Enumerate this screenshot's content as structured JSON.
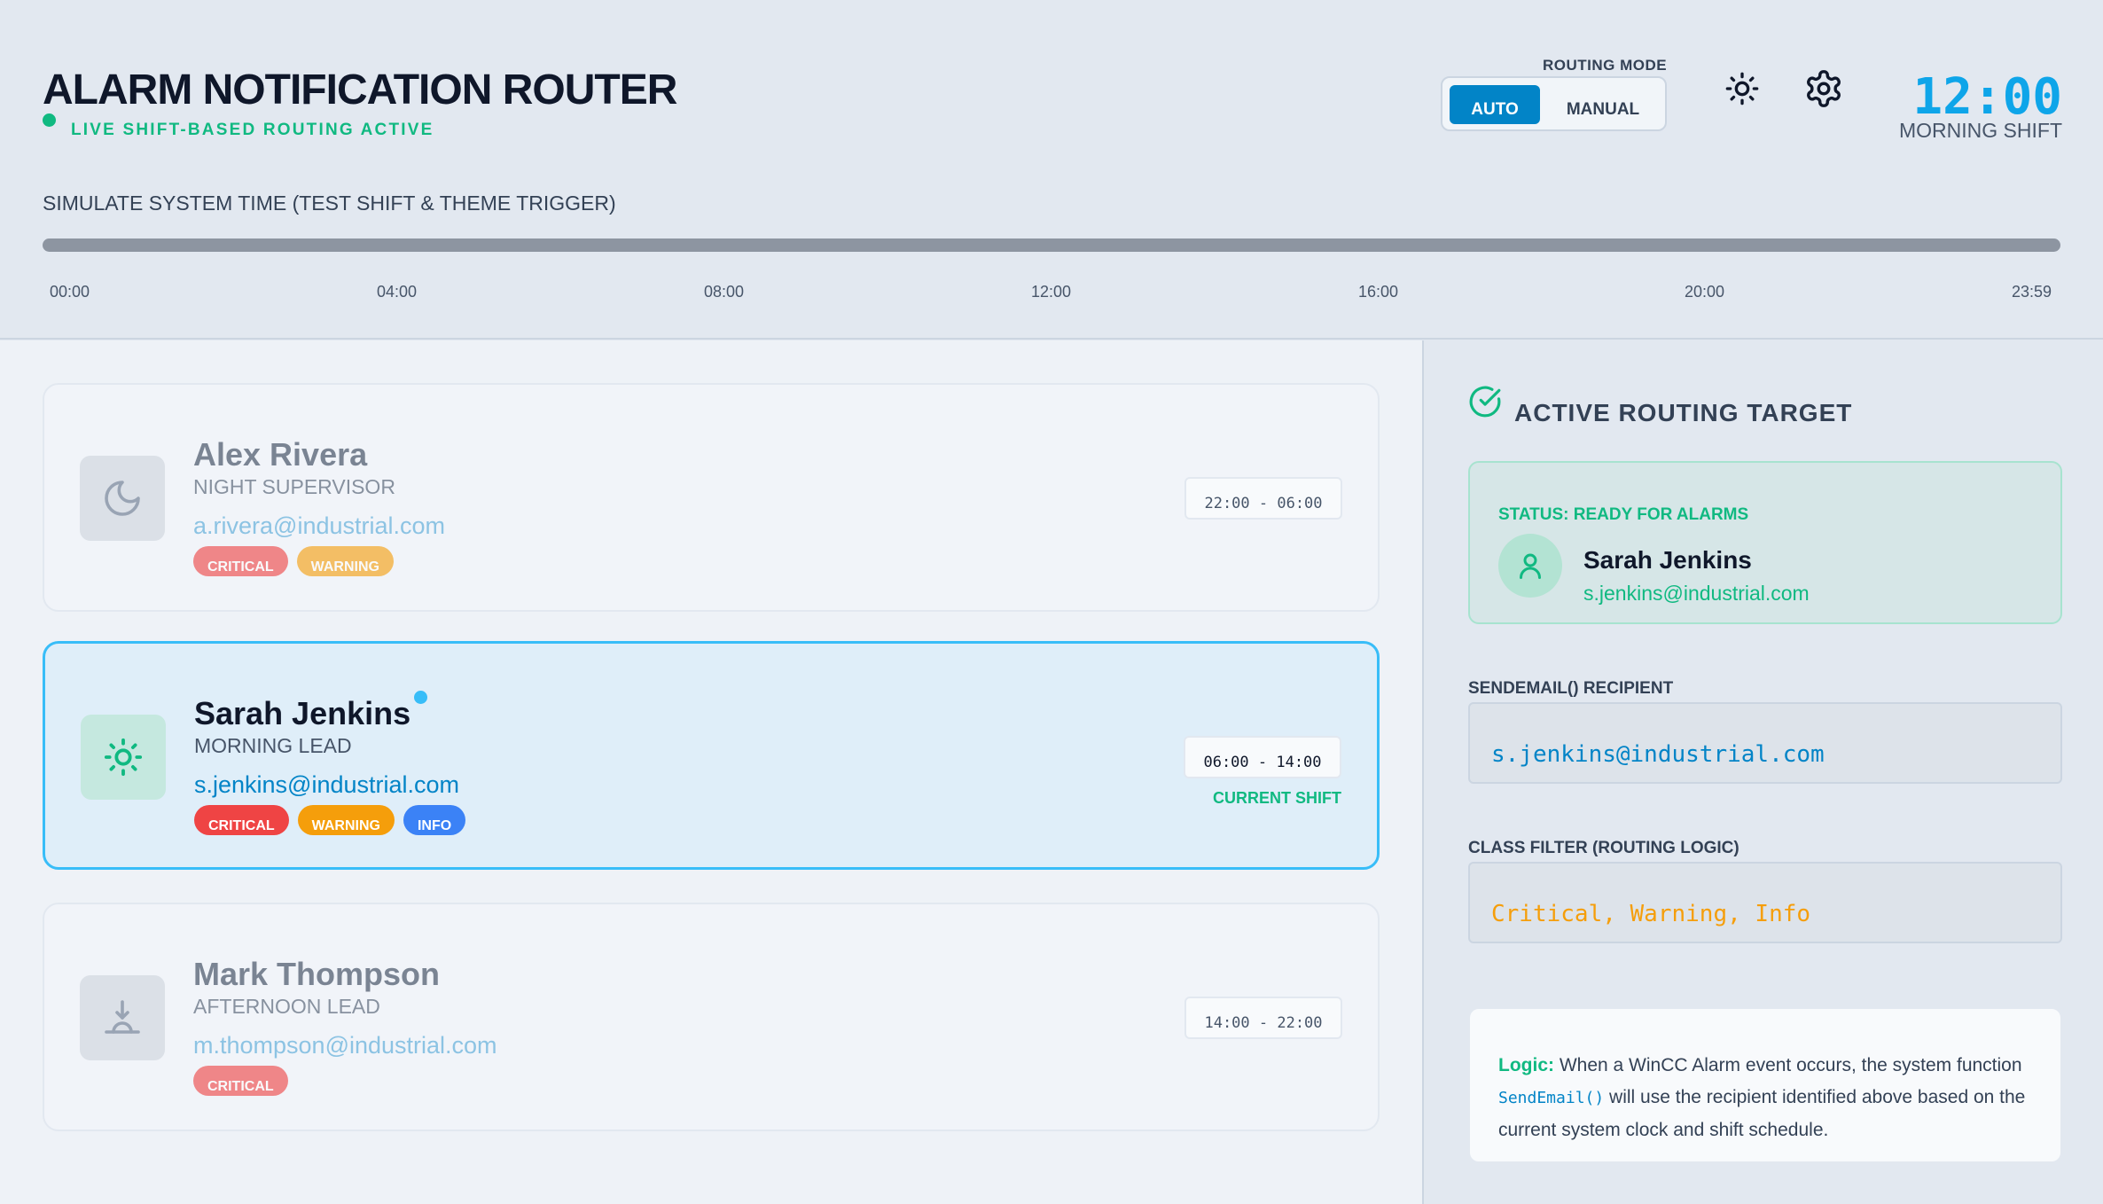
{
  "header": {
    "title": "ALARM NOTIFICATION ROUTER",
    "live_status": "LIVE SHIFT-BASED ROUTING ACTIVE",
    "routing_mode_label": "ROUTING MODE",
    "routing_mode_options": [
      "AUTO",
      "MANUAL"
    ],
    "routing_mode_selected": "AUTO",
    "clock": "12:00",
    "shift_name": "MORNING SHIFT",
    "theme_icon": "sun-icon",
    "settings_icon": "gear-icon"
  },
  "simulator": {
    "label": "SIMULATE SYSTEM TIME (TEST SHIFT & THEME TRIGGER)",
    "ticks": [
      "00:00",
      "04:00",
      "08:00",
      "12:00",
      "16:00",
      "20:00",
      "23:59"
    ]
  },
  "contacts": [
    {
      "name": "Alex Rivera",
      "role": "NIGHT SUPERVISOR",
      "email": "a.rivera@industrial.com",
      "classes": [
        "CRITICAL",
        "WARNING"
      ],
      "shift_hours": "22:00 - 06:00",
      "icon": "moon-icon",
      "active": false
    },
    {
      "name": "Sarah Jenkins",
      "role": "MORNING LEAD",
      "email": "s.jenkins@industrial.com",
      "classes": [
        "CRITICAL",
        "WARNING",
        "INFO"
      ],
      "shift_hours": "06:00 - 14:00",
      "current_shift_label": "CURRENT SHIFT",
      "icon": "sun-icon",
      "active": true
    },
    {
      "name": "Mark Thompson",
      "role": "AFTERNOON LEAD",
      "email": "m.thompson@industrial.com",
      "classes": [
        "CRITICAL"
      ],
      "shift_hours": "14:00 - 22:00",
      "icon": "sunset-icon",
      "active": false
    }
  ],
  "panel": {
    "title": "ACTIVE ROUTING TARGET",
    "status": "STATUS: READY FOR ALARMS",
    "target_name": "Sarah Jenkins",
    "target_email": "s.jenkins@industrial.com",
    "recipient_label": "SENDEMAIL() RECIPIENT",
    "recipient_value": "s.jenkins@industrial.com",
    "class_filter_label": "CLASS FILTER (ROUTING LOGIC)",
    "class_filter_value": "Critical, Warning, Info",
    "logic_title": "Logic:",
    "logic_text_1": " When a WinCC Alarm event occurs, the system function ",
    "logic_code": "SendEmail()",
    "logic_text_2": " will use the recipient identified above based on the current system clock and shift schedule."
  },
  "colors": {
    "accent": "#0284c7",
    "success": "#10b981",
    "critical": "#ef4444",
    "warning": "#f59e0b",
    "info": "#3b82f6",
    "clock": "#0ea5e9"
  }
}
